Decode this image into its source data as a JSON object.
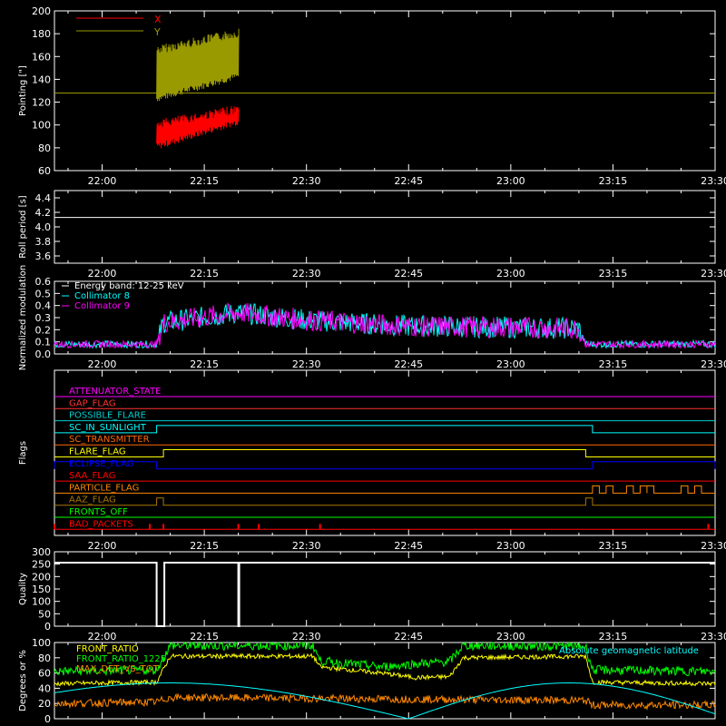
{
  "time_ticks": [
    "22:00",
    "22:15",
    "22:30",
    "22:45",
    "23:00",
    "23:15",
    "23:30"
  ],
  "chart_data": [
    {
      "type": "line",
      "ylabel": "Pointing [\"]",
      "ylim": [
        60,
        200
      ],
      "yticks": [
        "60",
        "80",
        "100",
        "120",
        "140",
        "160",
        "180",
        "200"
      ],
      "legend": [
        {
          "name": "X",
          "color": "#ff0000"
        },
        {
          "name": "Y",
          "color": "#999900"
        }
      ],
      "series": [
        {
          "name": "X",
          "color": "#ff0000",
          "segment": [
            "22:08",
            "22:20"
          ],
          "values_start": [
            78,
            105
          ],
          "values_end": [
            100,
            118
          ],
          "flat": 128
        },
        {
          "name": "Y",
          "color": "#999900",
          "segment": [
            "22:08",
            "22:20"
          ],
          "values_start": [
            120,
            170
          ],
          "values_end": [
            140,
            185
          ],
          "flat": 128
        }
      ]
    },
    {
      "type": "line",
      "ylabel": "Roll period [s]",
      "ylim": [
        3.5,
        4.5
      ],
      "yticks": [
        "3.6",
        "3.8",
        "4.0",
        "4.2",
        "4.4"
      ],
      "series": [
        {
          "name": "",
          "color": "#ffffff",
          "value": 4.13
        }
      ]
    },
    {
      "type": "line",
      "ylabel": "Normalized modulation",
      "ylim": [
        0,
        0.6
      ],
      "yticks": [
        "0.0",
        "0.1",
        "0.2",
        "0.3",
        "0.4",
        "0.5",
        "0.6"
      ],
      "legend": [
        {
          "name": "Energy band: 12-25 keV",
          "color": "#ffffff"
        },
        {
          "name": "Collimator 8",
          "color": "#00ffff"
        },
        {
          "name": "Collimator 9",
          "color": "#ff00ff"
        }
      ],
      "profile": [
        [
          "21:53",
          0.08
        ],
        [
          "22:08",
          0.08
        ],
        [
          "22:09",
          0.26
        ],
        [
          "22:20",
          0.34
        ],
        [
          "22:30",
          0.28
        ],
        [
          "22:45",
          0.23
        ],
        [
          "23:00",
          0.22
        ],
        [
          "23:10",
          0.21
        ],
        [
          "23:11",
          0.08
        ],
        [
          "23:30",
          0.08
        ]
      ],
      "series": [
        {
          "name": "Collimator 8",
          "color": "#00ffff"
        },
        {
          "name": "Collimator 9",
          "color": "#ff00ff"
        }
      ]
    },
    {
      "type": "line",
      "ylabel": "Flags",
      "flags": [
        {
          "name": "ATTENUATOR_STATE",
          "color": "#ff00ff",
          "steps": []
        },
        {
          "name": "GAP_FLAG",
          "color": "#ff3333",
          "steps": []
        },
        {
          "name": "POSSIBLE_FLARE",
          "color": "#00cccc",
          "steps": []
        },
        {
          "name": "SC_IN_SUNLIGHT",
          "color": "#00ffff",
          "steps": [
            [
              "22:08",
              "23:12"
            ]
          ]
        },
        {
          "name": "SC_TRANSMITTER",
          "color": "#ff6600",
          "steps": []
        },
        {
          "name": "FLARE_FLAG",
          "color": "#ffff00",
          "steps": [
            [
              "22:09",
              "23:11"
            ]
          ]
        },
        {
          "name": "ECLIPSE_FLAG",
          "color": "#0000ff",
          "steps": [
            [
              "21:53",
              "22:08"
            ],
            [
              "23:12",
              "23:30"
            ]
          ]
        },
        {
          "name": "SAA_FLAG",
          "color": "#ff0000",
          "steps": []
        },
        {
          "name": "PARTICLE_FLAG",
          "color": "#ff8800",
          "steps": [
            [
              "23:12",
              "23:13"
            ],
            [
              "23:14",
              "23:15"
            ],
            [
              "23:17",
              "23:18"
            ],
            [
              "23:19",
              "23:20"
            ],
            [
              "23:20",
              "23:21"
            ],
            [
              "23:25",
              "23:26"
            ],
            [
              "23:27",
              "23:28"
            ]
          ]
        },
        {
          "name": "AAZ_FLAG",
          "color": "#aa7700",
          "steps": [
            [
              "22:08",
              "22:09"
            ],
            [
              "23:11",
              "23:12"
            ]
          ]
        },
        {
          "name": "FRONTS_OFF",
          "color": "#00ff00",
          "steps": []
        },
        {
          "name": "BAD_PACKETS",
          "color": "#ff0000",
          "spikes": [
            "21:53",
            "22:07",
            "22:09",
            "22:20",
            "22:23",
            "22:32",
            "23:29"
          ]
        }
      ]
    },
    {
      "type": "line",
      "ylabel": "Quality",
      "ylim": [
        0,
        300
      ],
      "yticks": [
        "0",
        "50",
        "100",
        "150",
        "200",
        "250",
        "300"
      ],
      "series": [
        {
          "name": "",
          "color": "#ffffff",
          "level": 256,
          "gaps": [
            [
              "22:08",
              "22:09"
            ],
            [
              "22:20",
              "22:20"
            ]
          ]
        }
      ]
    },
    {
      "type": "line",
      "ylabel": "Degrees or %",
      "ylim": [
        0,
        100
      ],
      "yticks": [
        "0",
        "20",
        "40",
        "60",
        "80",
        "100"
      ],
      "legend": [
        {
          "name": "FRONT_RATIO",
          "color": "#ffff00"
        },
        {
          "name": "FRONT_RATIO_1225",
          "color": "#00ff00"
        },
        {
          "name": "MAX_DET_VS_TOT",
          "color": "#ff8800"
        },
        {
          "name": "Absolute geomagnetic latitude",
          "color": "#00ffff"
        }
      ],
      "series": [
        {
          "name": "FRONT_RATIO",
          "color": "#ffff00",
          "levels": [
            [
              "21:53",
              46
            ],
            [
              "22:08",
              48
            ],
            [
              "22:10",
              82
            ],
            [
              "22:31",
              82
            ],
            [
              "22:32",
              68
            ],
            [
              "22:41",
              60
            ],
            [
              "22:46",
              54
            ],
            [
              "22:51",
              55
            ],
            [
              "22:53",
              80
            ],
            [
              "23:11",
              82
            ],
            [
              "23:12",
              48
            ],
            [
              "23:30",
              46
            ]
          ]
        },
        {
          "name": "FRONT_RATIO_1225",
          "color": "#00ff00",
          "levels": [
            [
              "21:53",
              62
            ],
            [
              "22:08",
              64
            ],
            [
              "22:10",
              96
            ],
            [
              "22:31",
              96
            ],
            [
              "22:32",
              76
            ],
            [
              "22:41",
              68
            ],
            [
              "22:46",
              72
            ],
            [
              "22:51",
              75
            ],
            [
              "22:53",
              96
            ],
            [
              "23:11",
              95
            ],
            [
              "23:12",
              64
            ],
            [
              "23:30",
              62
            ]
          ]
        },
        {
          "name": "MAX_DET_VS_TOT",
          "color": "#ff8800",
          "levels": [
            [
              "21:53",
              20
            ],
            [
              "22:08",
              22
            ],
            [
              "22:10",
              28
            ],
            [
              "23:11",
              24
            ],
            [
              "23:12",
              18
            ],
            [
              "23:30",
              18
            ]
          ]
        },
        {
          "name": "Absolute geomagnetic latitude",
          "color": "#00ffff",
          "latitude": {
            "peaks": [
              "22:22",
              "23:09"
            ],
            "zeros": [
              "21:35",
              "22:45",
              "23:32"
            ],
            "max": 47
          }
        }
      ]
    }
  ]
}
